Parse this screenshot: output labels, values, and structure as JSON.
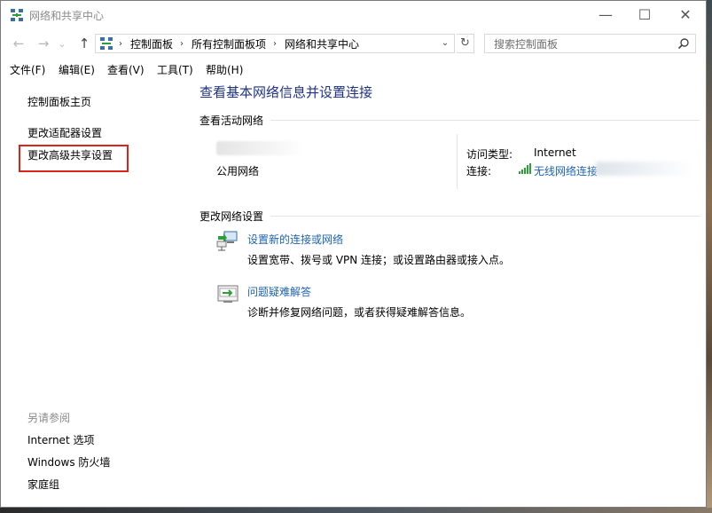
{
  "window": {
    "title": "网络和共享中心",
    "icon": "network-center-icon",
    "controls": {
      "minimize": "—",
      "maximize": "☐",
      "close": "✕"
    }
  },
  "nav": {
    "back": "←",
    "forward": "→",
    "dropdown": "⌄",
    "up": "↑"
  },
  "address": {
    "crumbs": [
      "控制面板",
      "所有控制面板项",
      "网络和共享中心"
    ],
    "separator": "›",
    "dropdown": "⌄",
    "refresh": "↻"
  },
  "search": {
    "placeholder": "搜索控制面板",
    "icon": "search-icon"
  },
  "menubar": [
    "文件(F)",
    "编辑(E)",
    "查看(V)",
    "工具(T)",
    "帮助(H)"
  ],
  "sidebar": {
    "links": [
      "控制面板主页",
      "更改适配器设置",
      "更改高级共享设置"
    ],
    "highlight_color": "#d9241c",
    "see_also_header": "另请参阅",
    "see_also": [
      "Internet 选项",
      "Windows 防火墙",
      "家庭组"
    ]
  },
  "main": {
    "title": "查看基本网络信息并设置连接",
    "active_networks_header": "查看活动网络",
    "network": {
      "type": "公用网络",
      "access_type_label": "访问类型:",
      "access_type_value": "Internet",
      "connection_label": "连接:",
      "connection_value": "无线网络连接"
    },
    "change_settings_header": "更改网络设置",
    "tasks": [
      {
        "icon": "new-connection-icon",
        "link": "设置新的连接或网络",
        "desc": "设置宽带、拨号或 VPN 连接；或设置路由器或接入点。"
      },
      {
        "icon": "troubleshoot-icon",
        "link": "问题疑难解答",
        "desc": "诊断并修复网络问题，或者获得疑难解答信息。"
      }
    ]
  },
  "colors": {
    "title_blue": "#1e3287",
    "link_blue": "#1e63b4",
    "signal_green": "#2e9e3a"
  }
}
